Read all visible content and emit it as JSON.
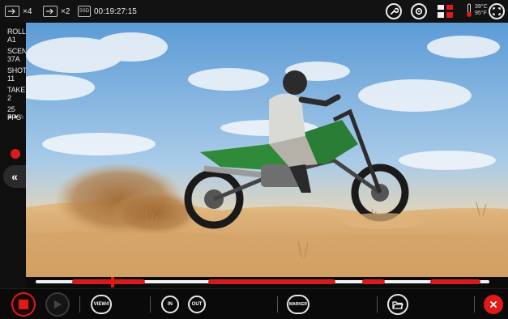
{
  "topbar": {
    "input_label": "×4",
    "output_label": "×2",
    "media_label": "SSD",
    "timecode": "00:19:27:15",
    "temp_c": "39°C",
    "temp_f": "95°F"
  },
  "metadata": {
    "roll_label": "ROLL",
    "roll_value": "A1",
    "scene_label": "SCENE",
    "scene_value": "37A",
    "shot_label": "SHOT",
    "shot_value": "11",
    "take_label": "TAKE",
    "take_value": "2",
    "fps": "25 FPS",
    "rating": "★★☆"
  },
  "collapse_label": "«",
  "timeline": {
    "playhead_position": 0.17,
    "marked_segments": [
      [
        0.08,
        0.24
      ],
      [
        0.38,
        0.66
      ],
      [
        0.72,
        0.77
      ],
      [
        0.87,
        0.98
      ]
    ]
  },
  "controls": {
    "view_label": "VIEW4",
    "in_label": "IN",
    "out_label": "OUT",
    "marker_label": "MARKER"
  },
  "colors": {
    "accent_red": "#e01919",
    "bar_bg": "#0b0b0b"
  }
}
